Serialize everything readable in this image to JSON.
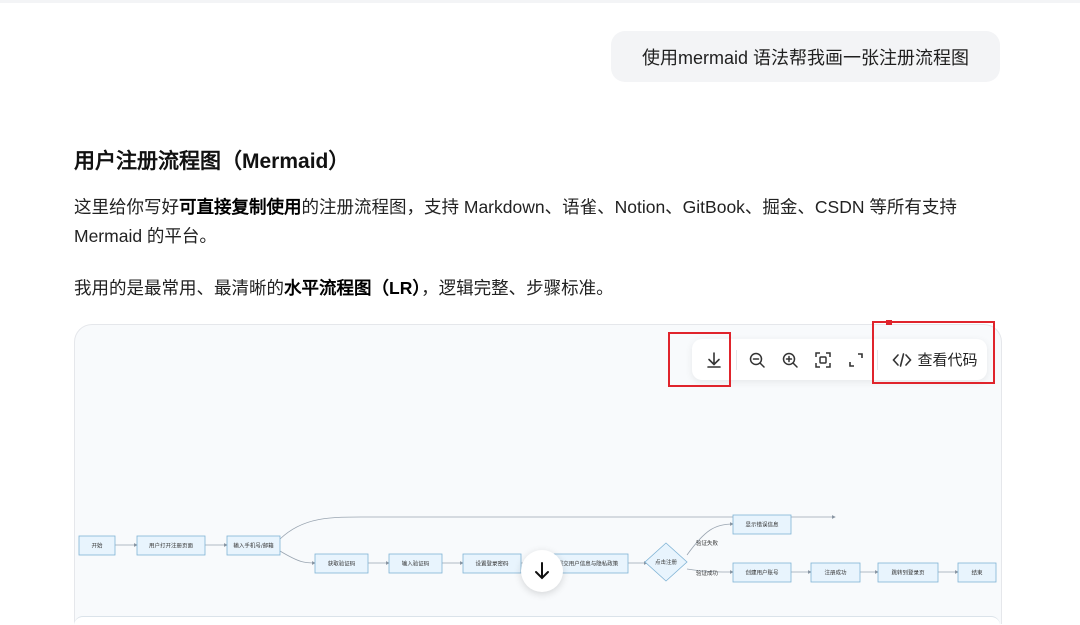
{
  "chat": {
    "user_message": "使用mermaid 语法帮我画一张注册流程图"
  },
  "answer": {
    "heading": "用户注册流程图（Mermaid）",
    "para1": {
      "before": "这里给你写好",
      "bold": "可直接复制使用",
      "after": "的注册流程图，支持 Markdown、语雀、Notion、GitBook、掘金、CSDN 等所有支持 Mermaid 的平台。"
    },
    "para2": {
      "before": "我用的是最常用、最清晰的",
      "bold": "水平流程图（LR）",
      "after": "，逻辑完整、步骤标准。"
    }
  },
  "toolbar": {
    "download_icon": "download-icon",
    "zoom_out_icon": "zoom-out-icon",
    "zoom_in_icon": "zoom-in-icon",
    "fit_icon": "fit-screen-icon",
    "fullscreen_icon": "fullscreen-icon",
    "view_code_label": "查看代码",
    "view_code_icon": "code-icon"
  },
  "flowchart": {
    "nodes": [
      "开始",
      "用户打开注册页面",
      "输入手机号/邮箱",
      "获取验证码",
      "输入验证码",
      "设置登录密码",
      "提交用户信息与隐私政策",
      "点击注册",
      "显示错误信息",
      "创建用户账号",
      "注册成功",
      "跳转到登录页",
      "结束"
    ],
    "edge_labels": [
      "验证失败",
      "验证成功"
    ]
  },
  "colors": {
    "highlight": "#e0242c",
    "node_fill": "#e8f4fd",
    "node_stroke": "#7fb3d5"
  },
  "scroll_icon": "arrow-down-icon"
}
